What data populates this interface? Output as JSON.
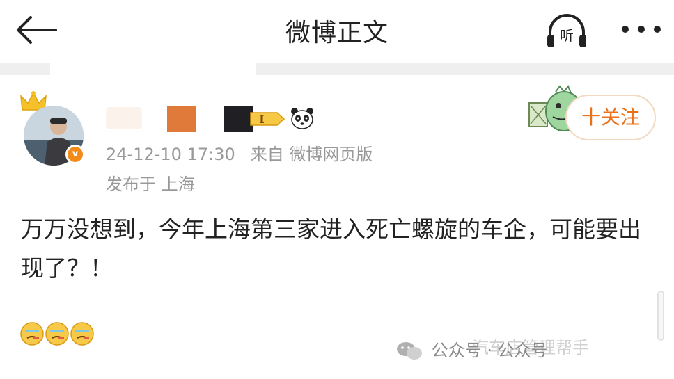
{
  "header": {
    "title": "微博正文",
    "listen_label": "听"
  },
  "post": {
    "meta": {
      "time": "24-12-10 17:30",
      "source": "来自 微博网页版",
      "location": "发布于 上海"
    },
    "verified_mark": "v",
    "badge_text": "I",
    "text": "万万没想到，今年上海第三家进入死亡螺旋的车企，可能要出现了？！",
    "emoji_count": 3
  },
  "follow": {
    "label": "十关注"
  },
  "watermark": {
    "front": "公众号 · 公众号",
    "back": "汽车店管理帮手"
  },
  "colors": {
    "accent_orange": "#e8711a",
    "verified_orange": "#f28b1a",
    "meta_gray": "#999999",
    "separator_gray": "#efefef"
  },
  "icons": [
    "back-arrow-icon",
    "headphone-icon",
    "more-icon",
    "crown-icon",
    "verified-icon",
    "level-badge-icon",
    "panda-icon",
    "mascot-icon",
    "emoji-icon",
    "wechat-icon"
  ]
}
